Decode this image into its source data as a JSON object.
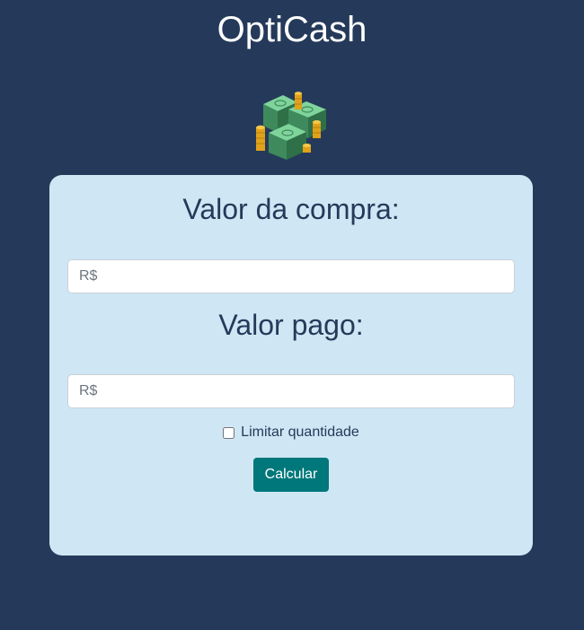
{
  "app": {
    "title": "OptiCash",
    "logo_icon": "money-stack-coins-icon"
  },
  "colors": {
    "background": "#253a5a",
    "card": "#cfe6f4",
    "text": "#253a5a",
    "button": "#00777a"
  },
  "form": {
    "purchase_label": "Valor da compra:",
    "purchase_placeholder": "R$",
    "paid_label": "Valor pago:",
    "paid_placeholder": "R$",
    "limit_label": "Limitar quantidade",
    "limit_checked": false,
    "calculate_label": "Calcular"
  }
}
